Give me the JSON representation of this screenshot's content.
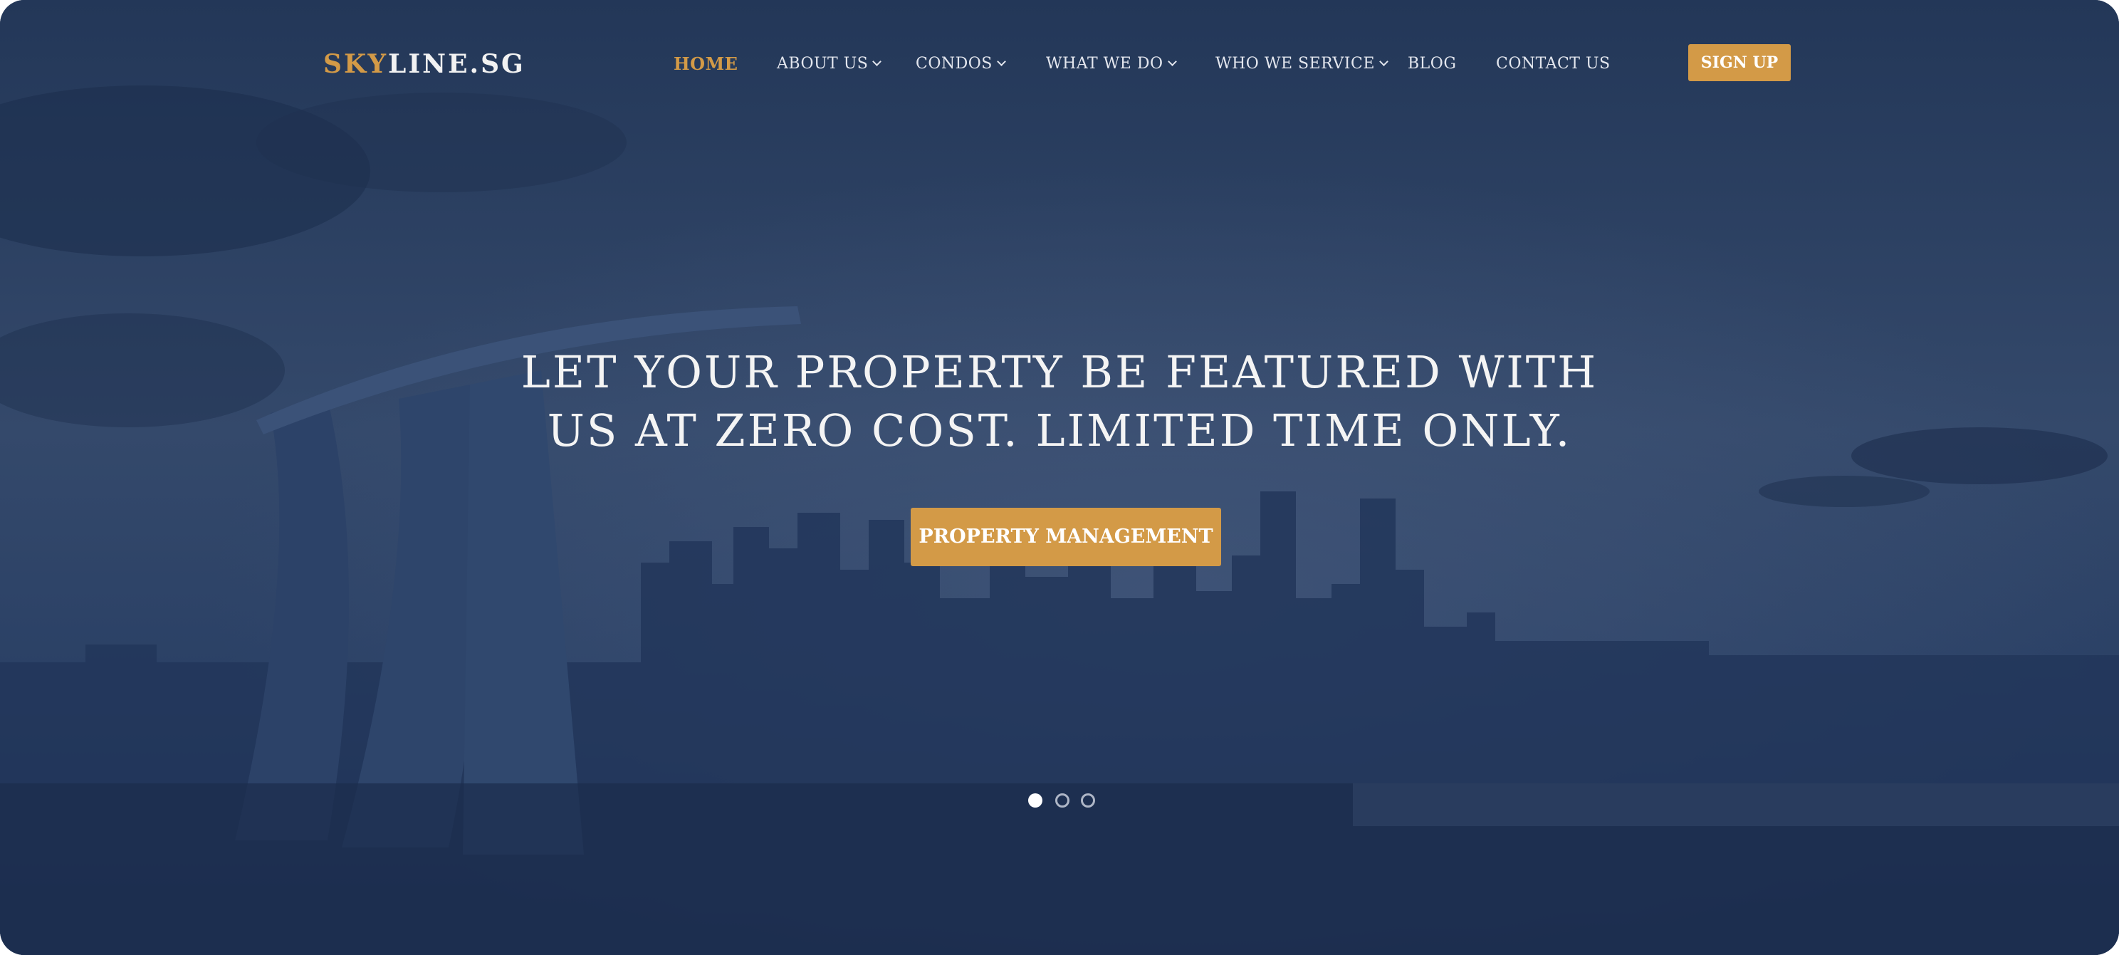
{
  "brand": {
    "logo_accent": "SKY",
    "logo_rest": "LINE.SG"
  },
  "nav": {
    "items": [
      {
        "label": "HOME",
        "active": true
      },
      {
        "label": "ABOUT US",
        "dropdown": true
      },
      {
        "label": "CONDOS",
        "dropdown": true
      },
      {
        "label": "WHAT WE DO",
        "dropdown": true
      },
      {
        "label": "WHO WE SERVICE",
        "dropdown": true
      },
      {
        "label": "BLOG"
      },
      {
        "label": "CONTACT US"
      }
    ],
    "signup_label": "SIGN UP"
  },
  "hero": {
    "headline_line1": "LET YOUR PROPERTY BE FEATURED WITH",
    "headline_line2": "US AT ZERO COST. LIMITED TIME ONLY.",
    "cta_label": "PROPERTY MANAGEMENT",
    "slides": {
      "count": 3,
      "active": 1
    }
  },
  "icons": {
    "dropdown": "chevron-down-icon"
  },
  "colors": {
    "accent": "#d39a47",
    "overlay": "#1f3356",
    "text": "#f4f4f4"
  }
}
